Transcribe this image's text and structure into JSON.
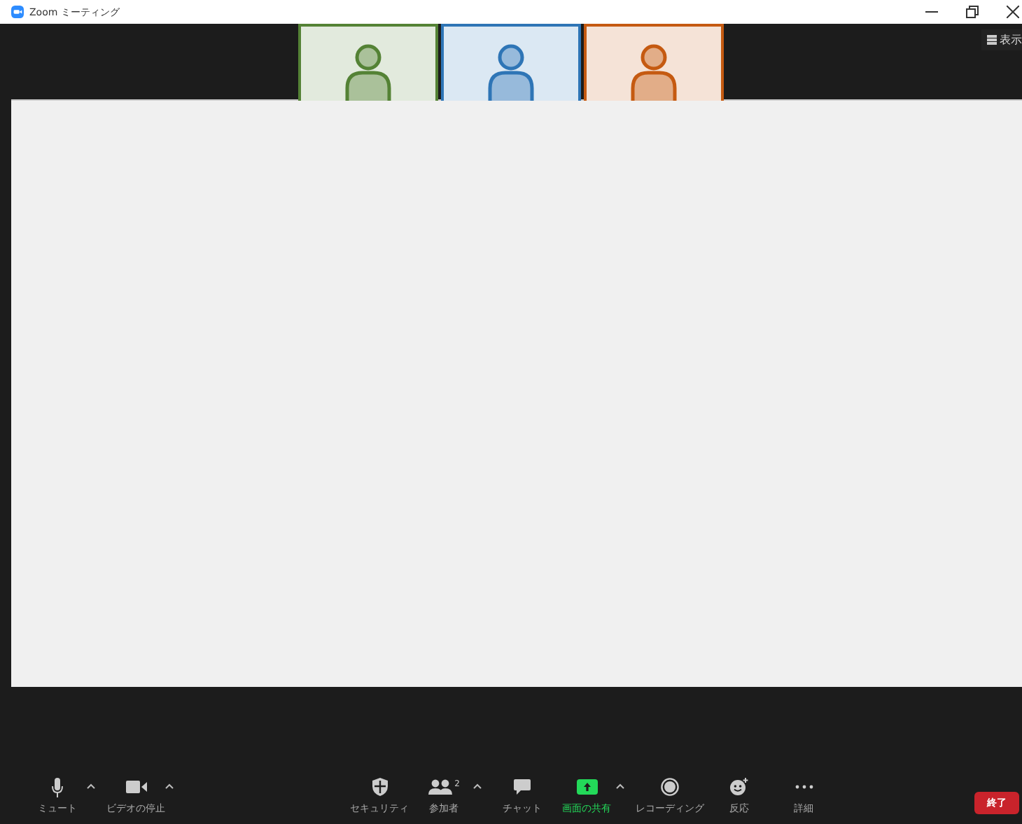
{
  "window": {
    "title": "Zoom ミーティング"
  },
  "view_button": {
    "label": "表示"
  },
  "participants": [
    {
      "color": "#548235"
    },
    {
      "color": "#2e75b6"
    },
    {
      "color": "#c55a11"
    }
  ],
  "toolbar": {
    "left": [
      {
        "kind": "mic",
        "label": "ミュート",
        "has_menu": true,
        "active": false
      },
      {
        "kind": "video",
        "label": "ビデオの停止",
        "has_menu": true,
        "active": false
      }
    ],
    "center": [
      {
        "kind": "security",
        "label": "セキュリティ",
        "has_menu": false,
        "active": false
      },
      {
        "kind": "participants",
        "label": "参加者",
        "count": "2",
        "has_menu": true,
        "active": false
      },
      {
        "kind": "chat",
        "label": "チャット",
        "has_menu": false,
        "active": false
      },
      {
        "kind": "share",
        "label": "画面の共有",
        "has_menu": true,
        "active": true
      },
      {
        "kind": "record",
        "label": "レコーディング",
        "has_menu": false,
        "active": false
      },
      {
        "kind": "reaction",
        "label": "反応",
        "has_menu": false,
        "active": false
      },
      {
        "kind": "more",
        "label": "詳細",
        "has_menu": false,
        "active": false
      }
    ],
    "end_button": {
      "label": "終了"
    }
  }
}
